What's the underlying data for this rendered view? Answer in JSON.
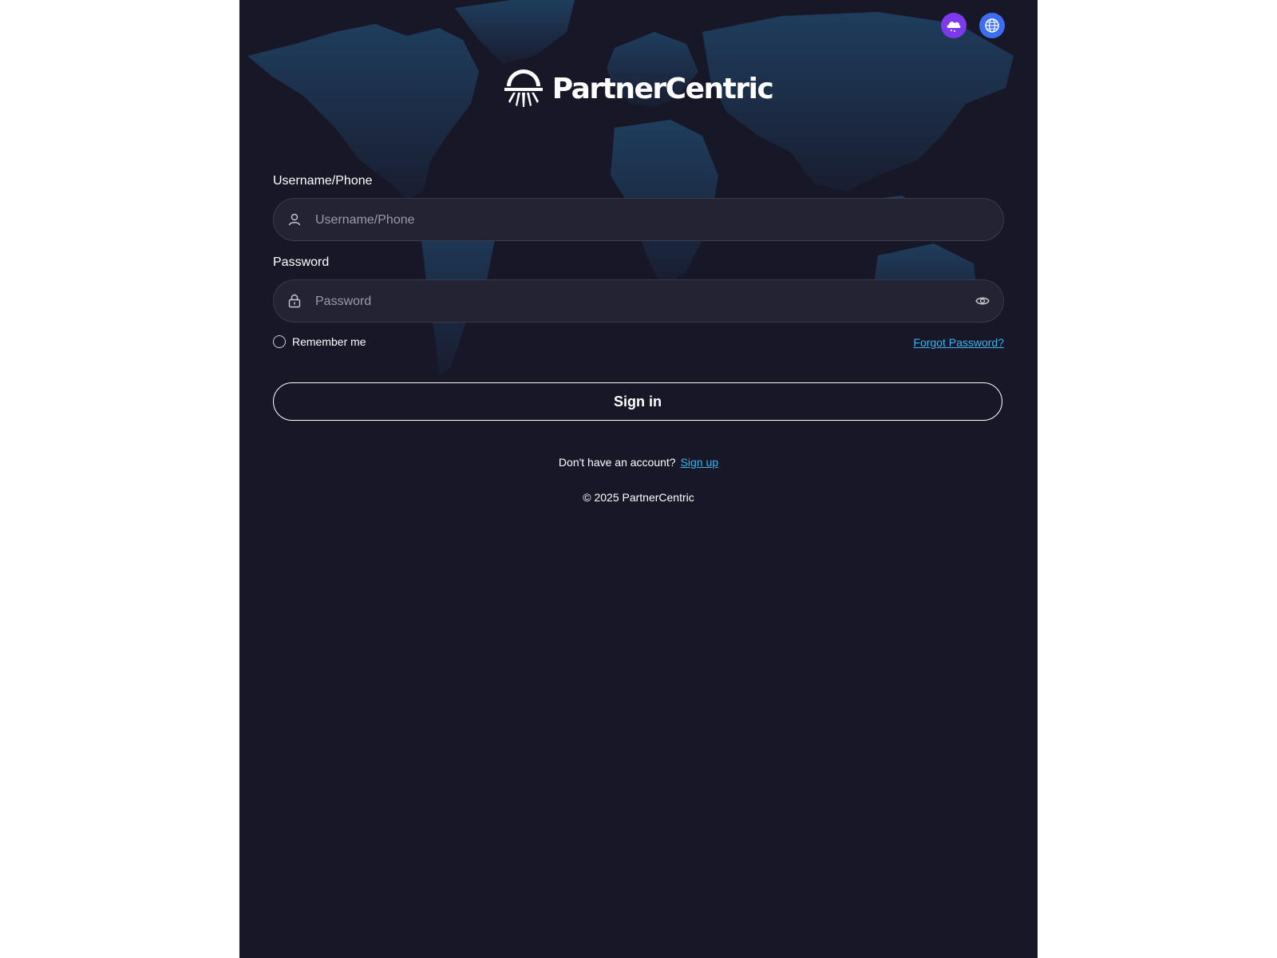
{
  "brand": {
    "name": "PartnerCentric"
  },
  "top_icons": [
    {
      "icon": "theme-icon",
      "color": "#7c3aed"
    },
    {
      "icon": "globe-icon",
      "color": "#3b6ef0"
    }
  ],
  "form": {
    "username_label": "Username/Phone",
    "username_placeholder": "Username/Phone",
    "password_label": "Password",
    "password_placeholder": "Password",
    "remember_label": "Remember me",
    "forgot_label": "Forgot Password?",
    "signin_label": "Sign in"
  },
  "signup": {
    "prompt": "Don't have an account?",
    "link": "Sign up"
  },
  "footer": {
    "copyright": "© 2025 PartnerCentric"
  },
  "colors": {
    "background": "#181728",
    "field": "#232333",
    "link": "#3ab4f0",
    "map": "#1d3550"
  }
}
